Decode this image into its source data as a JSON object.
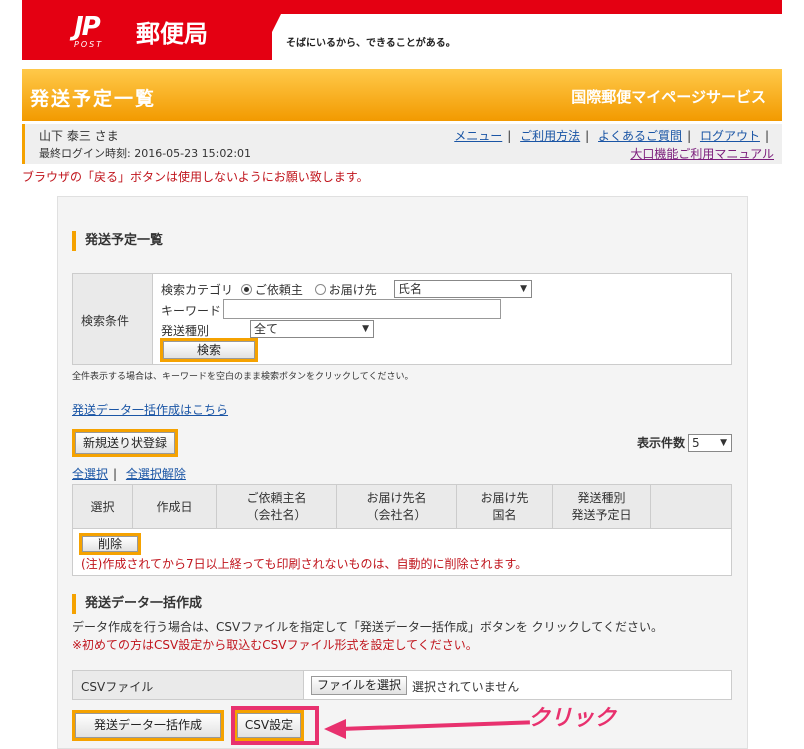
{
  "header": {
    "logo_mark": "JP",
    "logo_post": "POST",
    "logo_name": "郵便局",
    "slogan": "そばにいるから、できることがある。",
    "page_title": "発送予定一覧",
    "service_title": "国際郵便マイページサービス"
  },
  "userbar": {
    "user_name": "山下 泰三 さま",
    "last_login": "最終ログイン時刻: 2016-05-23 15:02:01",
    "links": [
      "メニュー",
      "ご利用方法",
      "よくあるご質問",
      "ログアウト"
    ],
    "manual": "大口機能ご利用マニュアル"
  },
  "warning": "ブラウザの「戻る」ボタンは使用しないようにお願い致します。",
  "list_section": {
    "title": "発送予定一覧",
    "search": {
      "label": "検索条件",
      "category_label": "検索カテゴリ",
      "radio_requester": "ご依頼主",
      "radio_recipient": "お届け先",
      "category_select": "氏名",
      "keyword_label": "キーワード",
      "keyword_value": "",
      "type_label": "発送種別",
      "type_select": "全て",
      "search_button": "検索"
    },
    "note": "全件表示する場合は、キーワードを空白のまま検索ボタンをクリックしてください。",
    "bulk_link": "発送データ一括作成はこちら",
    "new_button": "新規送り状登録",
    "count_label": "表示件数",
    "count_value": "5",
    "select_all": "全選択",
    "deselect_all": "全選択解除",
    "columns": [
      {
        "l1": "選択",
        "l2": ""
      },
      {
        "l1": "作成日",
        "l2": ""
      },
      {
        "l1": "ご依頼主名",
        "l2": "（会社名）"
      },
      {
        "l1": "お届け先名",
        "l2": "（会社名）"
      },
      {
        "l1": "お届け先",
        "l2": "国名"
      },
      {
        "l1": "発送種別",
        "l2": "発送予定日"
      }
    ],
    "delete_button": "削除",
    "delete_note": "(注)作成されてから7日以上経っても印刷されないものは、自動的に削除されます。"
  },
  "bulk_section": {
    "title": "発送データ一括作成",
    "desc1": "データ作成を行う場合は、CSVファイルを指定して「発送データ一括作成」ボタンを クリックしてください。",
    "desc2": "※初めての方はCSV設定から取込むCSVファイル形式を設定してください。",
    "csv_label": "CSVファイル",
    "file_button": "ファイルを選択",
    "file_status": "選択されていません",
    "create_button": "発送データ一括作成",
    "csv_setting_button": "CSV設定"
  },
  "annotation": {
    "click_text": "クリック"
  },
  "colors": {
    "brand_red": "#e40012",
    "orange": "#f5a200",
    "annotation_pink": "#e8316e",
    "link_blue": "#1a55a5",
    "warning_red": "#c0141c"
  }
}
